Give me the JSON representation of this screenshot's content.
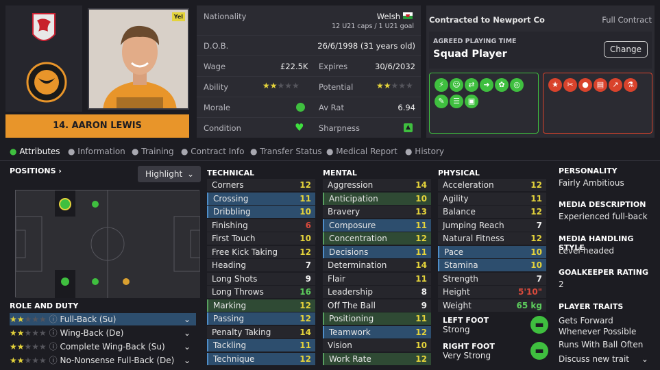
{
  "player": {
    "name": "14. AARON LEWIS",
    "badge_label": "Yel"
  },
  "info": {
    "nationality_label": "Nationality",
    "nationality": "Welsh",
    "caps": "12 U21 caps / 1 U21 goal",
    "dob_label": "D.O.B.",
    "dob": "26/6/1998 (31 years old)",
    "wage_label": "Wage",
    "wage": "£22.5K",
    "expires_label": "Expires",
    "expires": "30/6/2032",
    "ability_label": "Ability",
    "potential_label": "Potential",
    "morale_label": "Morale",
    "avrat_label": "Av Rat",
    "avrat": "6.94",
    "condition_label": "Condition",
    "sharpness_label": "Sharpness"
  },
  "contract": {
    "club": "Contracted to Newport Co",
    "type": "Full Contract",
    "apt_label": "AGREED PLAYING TIME",
    "apt": "Squad Player",
    "change_btn": "Change"
  },
  "tabs": [
    "Attributes",
    "Information",
    "Training",
    "Contract Info",
    "Transfer Status",
    "Medical Report",
    "History"
  ],
  "positions": {
    "label": "POSITIONS",
    "highlight": "Highlight"
  },
  "role_duty": {
    "label": "ROLE AND DUTY",
    "roles": [
      "Full-Back (Su)",
      "Wing-Back (De)",
      "Complete Wing-Back (Su)",
      "No-Nonsense Full-Back (De)"
    ]
  },
  "technical": {
    "label": "TECHNICAL",
    "rows": [
      {
        "n": "Corners",
        "v": "12"
      },
      {
        "n": "Crossing",
        "v": "11"
      },
      {
        "n": "Dribbling",
        "v": "10"
      },
      {
        "n": "Finishing",
        "v": "6"
      },
      {
        "n": "First Touch",
        "v": "10"
      },
      {
        "n": "Free Kick Taking",
        "v": "12"
      },
      {
        "n": "Heading",
        "v": "7"
      },
      {
        "n": "Long Shots",
        "v": "9"
      },
      {
        "n": "Long Throws",
        "v": "16"
      },
      {
        "n": "Marking",
        "v": "12"
      },
      {
        "n": "Passing",
        "v": "12"
      },
      {
        "n": "Penalty Taking",
        "v": "14"
      },
      {
        "n": "Tackling",
        "v": "11"
      },
      {
        "n": "Technique",
        "v": "12"
      }
    ]
  },
  "mental": {
    "label": "MENTAL",
    "rows": [
      {
        "n": "Aggression",
        "v": "14"
      },
      {
        "n": "Anticipation",
        "v": "10"
      },
      {
        "n": "Bravery",
        "v": "13"
      },
      {
        "n": "Composure",
        "v": "11"
      },
      {
        "n": "Concentration",
        "v": "12"
      },
      {
        "n": "Decisions",
        "v": "11"
      },
      {
        "n": "Determination",
        "v": "14"
      },
      {
        "n": "Flair",
        "v": "11"
      },
      {
        "n": "Leadership",
        "v": "8"
      },
      {
        "n": "Off The Ball",
        "v": "9"
      },
      {
        "n": "Positioning",
        "v": "11"
      },
      {
        "n": "Teamwork",
        "v": "12"
      },
      {
        "n": "Vision",
        "v": "10"
      },
      {
        "n": "Work Rate",
        "v": "12"
      }
    ]
  },
  "physical": {
    "label": "PHYSICAL",
    "rows": [
      {
        "n": "Acceleration",
        "v": "12"
      },
      {
        "n": "Agility",
        "v": "11"
      },
      {
        "n": "Balance",
        "v": "12"
      },
      {
        "n": "Jumping Reach",
        "v": "7"
      },
      {
        "n": "Natural Fitness",
        "v": "12"
      },
      {
        "n": "Pace",
        "v": "10"
      },
      {
        "n": "Stamina",
        "v": "10"
      },
      {
        "n": "Strength",
        "v": "7"
      },
      {
        "n": "Height",
        "v": "5'10\""
      },
      {
        "n": "Weight",
        "v": "65 kg"
      }
    ],
    "left_foot_label": "LEFT FOOT",
    "left_foot": "Strong",
    "right_foot_label": "RIGHT FOOT",
    "right_foot": "Very Strong"
  },
  "side": {
    "personality_label": "PERSONALITY",
    "personality": "Fairly Ambitious",
    "media_desc_label": "MEDIA DESCRIPTION",
    "media_desc": "Experienced full-back",
    "media_style_label": "MEDIA HANDLING STYLE",
    "media_style": "Level-headed",
    "gk_label": "GOALKEEPER RATING",
    "gk": "2",
    "traits_label": "PLAYER TRAITS",
    "traits": [
      "Gets Forward Whenever Possible",
      "Runs With Ball Often"
    ],
    "discuss": "Discuss new trait"
  },
  "colors": {
    "accent": "#e8952a",
    "stars": "#e4d33b",
    "green_icons": "#3fbf3f",
    "red_icons": "#d9432c"
  }
}
